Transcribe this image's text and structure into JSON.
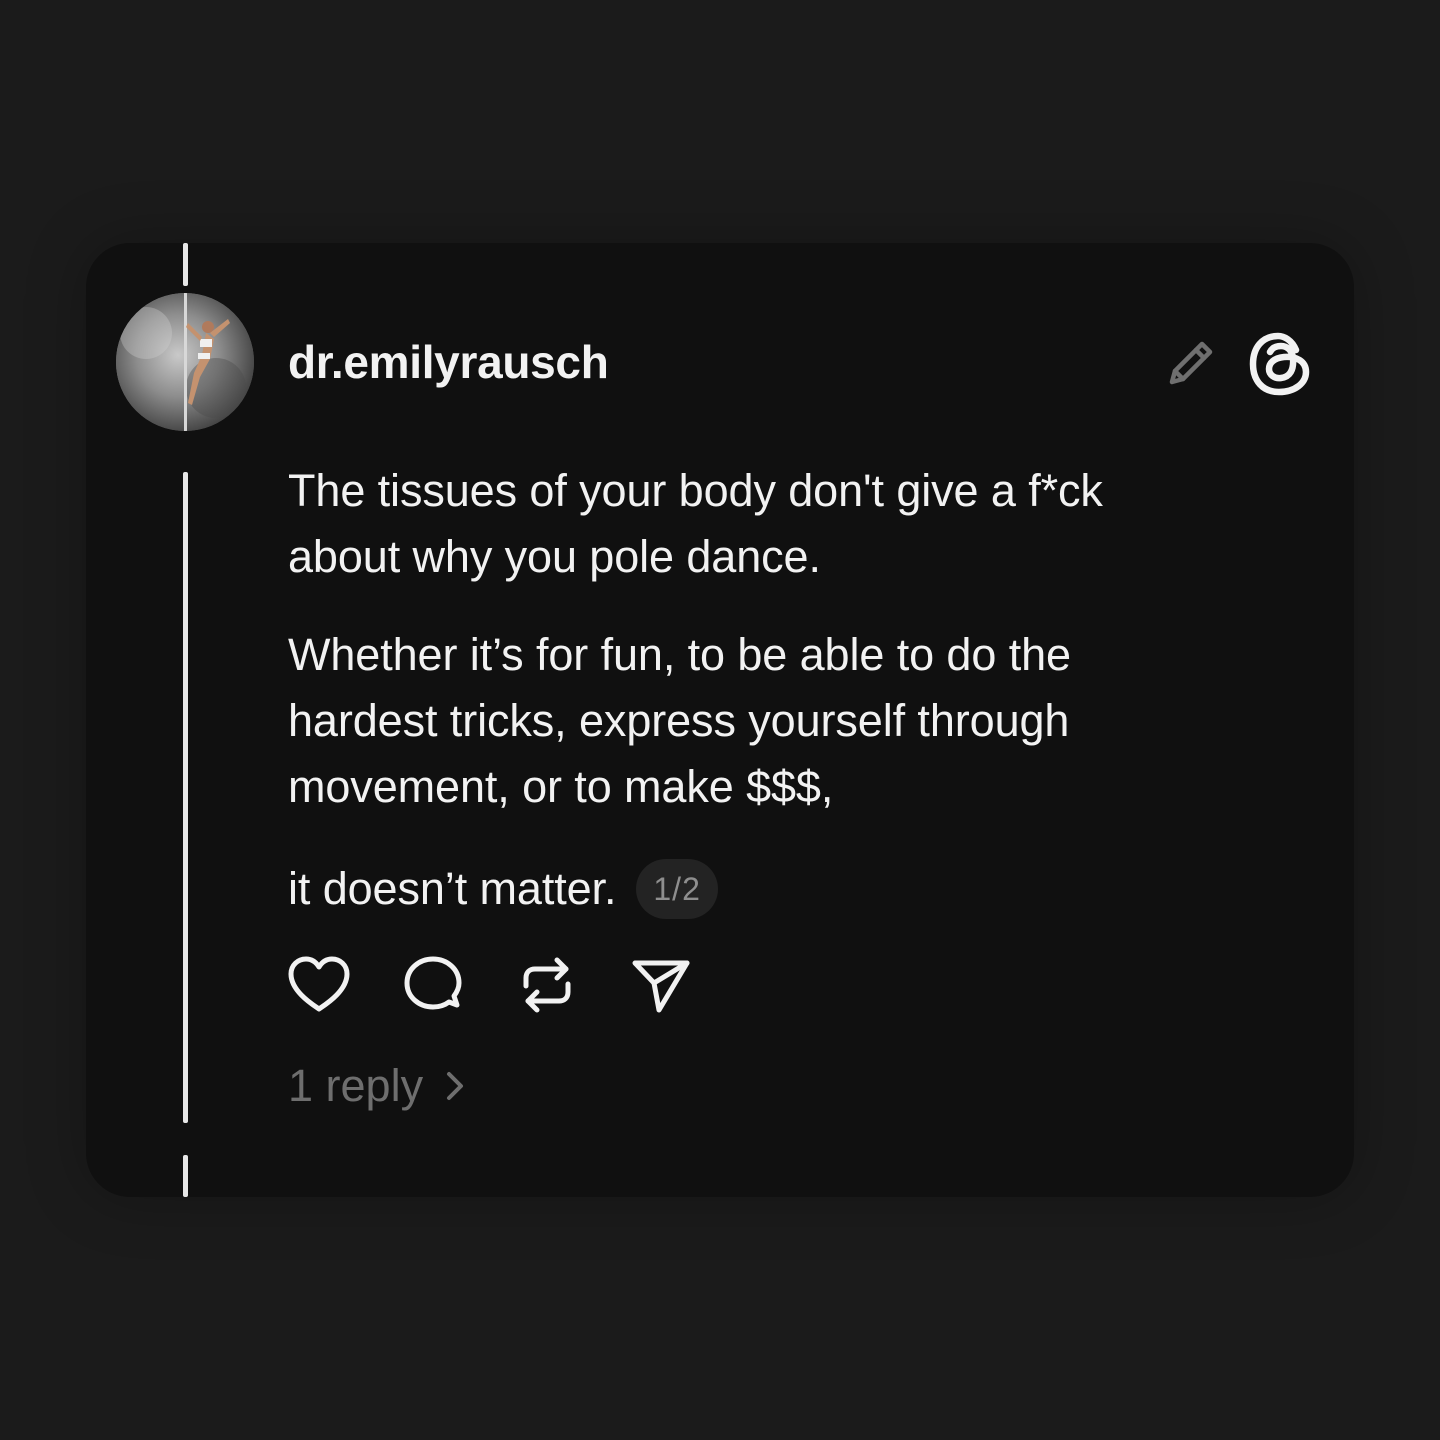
{
  "post": {
    "username": "dr.emilyrausch",
    "paragraphs": {
      "p1_line1": "The tissues of your body don't give a f*ck",
      "p1_line2": "about why you pole dance.",
      "p2_line1": "Whether it’s for fun, to be able to do the",
      "p2_line2": "hardest tricks, express yourself through",
      "p2_line3": "movement, or to make $$$,",
      "p3_line1": "it doesn’t matter."
    },
    "page_indicator": "1/2",
    "reply_count_label": "1 reply"
  },
  "icons": {
    "edit": "pencil-icon",
    "brand": "threads-logo-icon",
    "like": "heart-icon",
    "comment": "comment-bubble-icon",
    "repost": "repost-icon",
    "share": "send-icon",
    "reply_chevron": "chevron-right-icon"
  },
  "colors": {
    "page_background": "#1b1b1b",
    "card_background": "#101010",
    "text_primary": "#f2f2f2",
    "text_secondary": "#6e6e6e",
    "badge_background": "#232323"
  }
}
